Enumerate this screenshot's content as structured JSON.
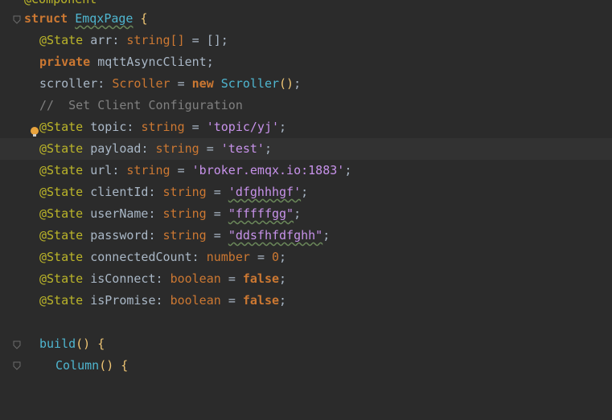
{
  "editor": {
    "lines": [
      {
        "text": "@Component"
      },
      {
        "kw": "struct",
        "name": "EmqxPage",
        "brace": "{"
      },
      {
        "ann": "@State",
        "field": "arr",
        "type": "string[]",
        "op": "=",
        "value": "[]",
        "end": ";"
      },
      {
        "kw": "private",
        "field": "mqttAsyncClient",
        "end": ";"
      },
      {
        "field": "scroller",
        "type": "Scroller",
        "op": "=",
        "new": "new",
        "cls": "Scroller",
        "call": "()",
        "end": ";"
      },
      {
        "comment": "//  Set Client Configuration"
      },
      {
        "ann": "@State",
        "field": "topic",
        "type": "string",
        "op": "=",
        "value": "'topic/yj'",
        "end": ";"
      },
      {
        "ann": "@State",
        "field": "payload",
        "type": "string",
        "op": "=",
        "value": "'test'",
        "end": ";"
      },
      {
        "ann": "@State",
        "field": "url",
        "type": "string",
        "op": "=",
        "value": "'broker.emqx.io:1883'",
        "end": ";"
      },
      {
        "ann": "@State",
        "field": "clientId",
        "type": "string",
        "op": "=",
        "value": "'dfghhhgf'",
        "end": ";"
      },
      {
        "ann": "@State",
        "field": "userName",
        "type": "string",
        "op": "=",
        "value": "\"fffffgg\"",
        "end": ";"
      },
      {
        "ann": "@State",
        "field": "password",
        "type": "string",
        "op": "=",
        "value": "\"ddsfhfdfghh\"",
        "end": ";"
      },
      {
        "ann": "@State",
        "field": "connectedCount",
        "type": "number",
        "op": "=",
        "value": "0",
        "end": ";"
      },
      {
        "ann": "@State",
        "field": "isConnect",
        "type": "boolean",
        "op": "=",
        "value": "false",
        "end": ";"
      },
      {
        "ann": "@State",
        "field": "isPromise",
        "type": "boolean",
        "op": "=",
        "value": "false",
        "end": ";"
      },
      {
        "blank": ""
      },
      {
        "method": "build",
        "call": "()",
        "brace": "{"
      },
      {
        "cls": "Column",
        "call": "()",
        "brace": "{"
      }
    ]
  },
  "colors": {
    "background": "#2b2b2b",
    "current_line": "#323232",
    "annotation": "#bbb529",
    "keyword": "#cc7832",
    "string": "#c792ea",
    "class": "#4fb6d0",
    "comment": "#808080"
  }
}
